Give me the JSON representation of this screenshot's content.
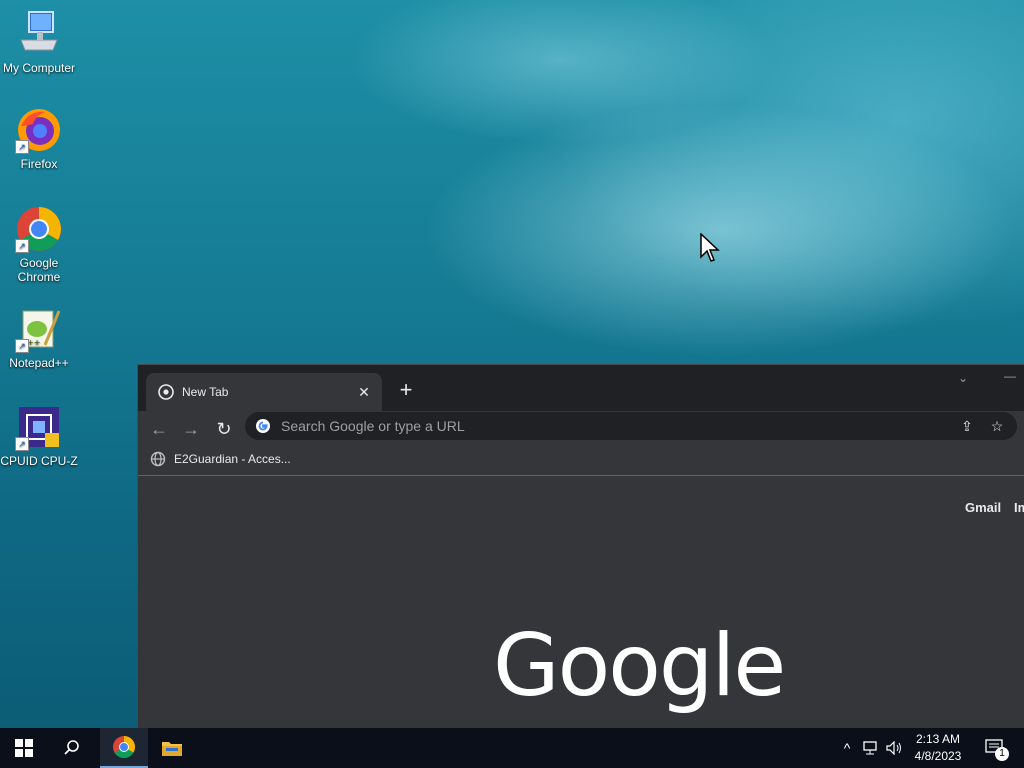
{
  "desktop": {
    "icons": [
      {
        "label": "My Computer"
      },
      {
        "label": "Firefox"
      },
      {
        "label": "Google Chrome"
      },
      {
        "label": "Notepad++"
      },
      {
        "label": "CPUID CPU-Z"
      }
    ]
  },
  "browser": {
    "tab_title": "New Tab",
    "new_tab_symbol": "+",
    "close_symbol": "✕",
    "omnibox_placeholder": "Search Google or type a URL",
    "bookmark_label": "E2Guardian - Acces...",
    "header_links": {
      "gmail": "Gmail",
      "images": "Im"
    },
    "logo_text": "Google"
  },
  "taskbar": {
    "time": "2:13 AM",
    "date": "4/8/2023",
    "notification_count": "1"
  },
  "colors": {
    "chrome_dark": "#35363a",
    "tabstrip": "#202124",
    "taskbar": "#0a0f1a"
  }
}
